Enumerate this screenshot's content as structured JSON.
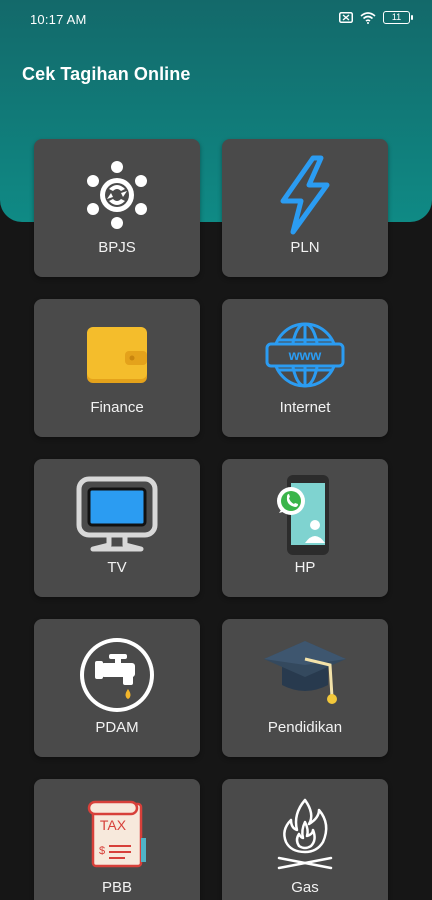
{
  "status_bar": {
    "time": "10:17 AM",
    "battery_level": "11",
    "icons": [
      "sim-card-icon",
      "wifi-icon",
      "battery-icon"
    ]
  },
  "header": {
    "title": "Cek Tagihan Online",
    "color": "#0f8a85"
  },
  "menu": {
    "items": [
      {
        "label": "BPJS",
        "icon": "bpjs-logo-icon"
      },
      {
        "label": "PLN",
        "icon": "lightning-icon"
      },
      {
        "label": "Finance",
        "icon": "wallet-icon"
      },
      {
        "label": "Internet",
        "icon": "globe-www-icon"
      },
      {
        "label": "TV",
        "icon": "tv-icon"
      },
      {
        "label": "HP",
        "icon": "smartphone-icon"
      },
      {
        "label": "PDAM",
        "icon": "water-tap-icon"
      },
      {
        "label": "Pendidikan",
        "icon": "graduation-cap-icon"
      },
      {
        "label": "PBB",
        "icon": "tax-document-icon"
      },
      {
        "label": "Gas",
        "icon": "gas-flame-icon"
      }
    ]
  }
}
